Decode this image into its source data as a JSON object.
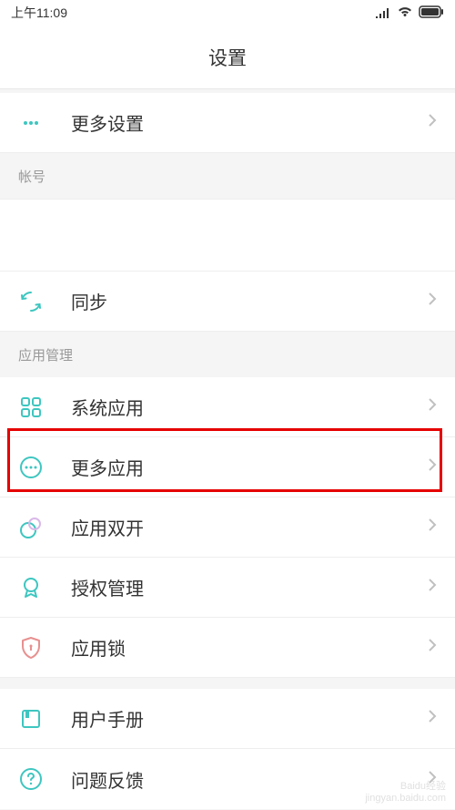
{
  "status_bar": {
    "time": "上午11:09"
  },
  "header": {
    "title": "设置"
  },
  "sections": {
    "more_settings": "更多设置",
    "account_header": "帐号",
    "sync": "同步",
    "app_mgmt_header": "应用管理",
    "system_apps": "系统应用",
    "more_apps": "更多应用",
    "dual_apps": "应用双开",
    "permissions": "授权管理",
    "app_lock": "应用锁",
    "user_manual": "用户手册",
    "feedback": "问题反馈"
  },
  "watermark": {
    "line1": "Baidu经验",
    "line2": "jingyan.baidu.com"
  }
}
